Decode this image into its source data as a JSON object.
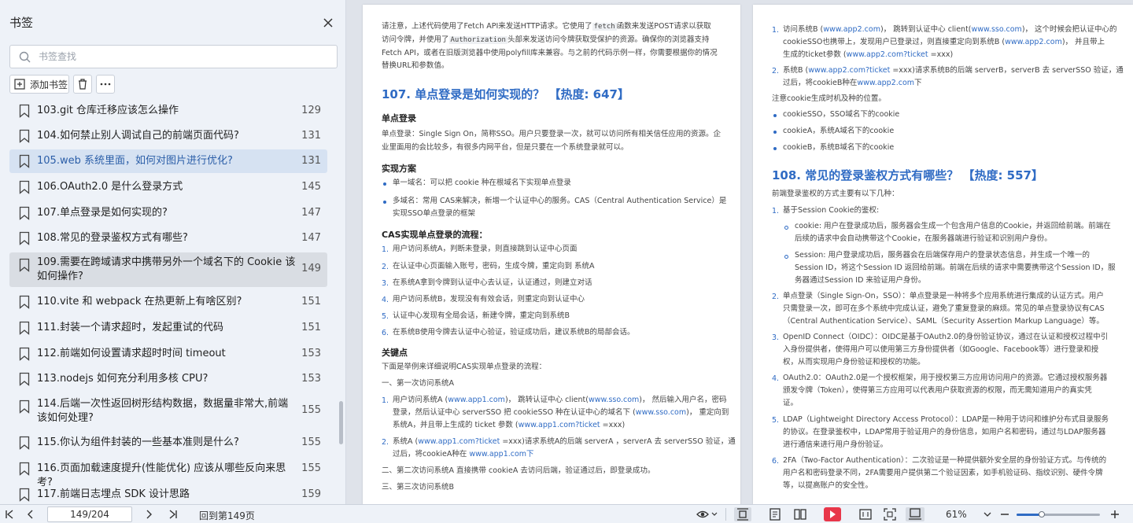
{
  "sidebar": {
    "title": "书签",
    "search_placeholder": "书签查找",
    "add_label": "添加书签",
    "items": [
      {
        "label": "103.git 仓库迁移应该怎么操作",
        "page": "129"
      },
      {
        "label": "104.如何禁止别人调试自己的前端页面代码?",
        "page": "131"
      },
      {
        "label": "105.web 系统里面，如何对图片进行优化?",
        "page": "131"
      },
      {
        "label": "106.OAuth2.0 是什么登录方式",
        "page": "145"
      },
      {
        "label": "107.单点登录是如何实现的?",
        "page": "147"
      },
      {
        "label": "108.常见的登录鉴权方式有哪些?",
        "page": "147"
      },
      {
        "label": "109.需要在跨域请求中携带另外一个域名下的 Cookie 该如何操作?",
        "page": "149"
      },
      {
        "label": "110.vite 和 webpack 在热更新上有啥区别?",
        "page": "151"
      },
      {
        "label": "111.封装一个请求超时，发起重试的代码",
        "page": "151"
      },
      {
        "label": "112.前端如何设置请求超时时间 timeout",
        "page": "153"
      },
      {
        "label": "113.nodejs 如何充分利用多核 CPU?",
        "page": "153"
      },
      {
        "label": "114.后端一次性返回树形结构数据，数据量非常大,前端该如何处理?",
        "page": "155"
      },
      {
        "label": "115.你认为组件封装的一些基本准则是什么?",
        "page": "155"
      },
      {
        "label": "116.页面加载速度提升(性能优化) 应该从哪些反向来思考?",
        "page": "155"
      },
      {
        "label": "117.前端日志埋点 SDK 设计思路",
        "page": "159"
      }
    ]
  },
  "left_page": {
    "intro_l1a": "请注意，上述代码使用了Fetch API来发送HTTP请求。它使用了",
    "intro_code1": "fetch",
    "intro_l1b": "函数来发送POST请求以获取",
    "intro_l2a": "访问令牌，并使用了",
    "intro_code2": "Authorization",
    "intro_l2b": "头部来发送访问令牌获取受保护的资源。确保你的浏览器支持",
    "intro_l3": "Fetch API，或者在旧版浏览器中使用polyfill库来兼容。与之前的代码示例一样，你需要根据你的情况",
    "intro_l4": "替换URL和参数值。",
    "heading": "107. 单点登录是如何实现的？ 【热度: 647】",
    "sso_title": "单点登录",
    "sso_l1": "单点登录：Single Sign On，简称SSO。用户只要登录一次，就可以访问所有相关信任应用的资源。企",
    "sso_l2": "业里面用的会比较多，有很多内网平台，但是只要在一个系统登录就可以。",
    "impl_title": "实现方案",
    "impl1": "单一域名：可以把 cookie 种在根域名下实现单点登录",
    "impl2_l1": "多域名：常用 CAS来解决，新增一个认证中心的服务。CAS（Central Authentication Service）是",
    "impl2_l2": "实现SSO单点登录的框架",
    "flow_title": "CAS实现单点登录的流程：",
    "flow": [
      "用户访问系统A，判断未登录，则直接跳到认证中心页面",
      "在认证中心页面输入账号，密码，生成令牌，重定向到 系统A",
      "在系统A拿到令牌到认证中心去认证，认证通过，则建立对话",
      "用户访问系统B，发现没有有效会话，则重定向到认证中心",
      "认证中心发现有全局会话，新建令牌，重定向到系统B",
      "在系统B使用令牌去认证中心验证，验证成功后，建议系统B的局部会话。"
    ],
    "key_title": "关键点",
    "key_intro": "下面是举例来详细说明CAS实现单点登录的流程：",
    "step1": "一、第一次访问系统A",
    "s1_a": "用户访问系统A (",
    "s1_link1": "www.app1.com",
    "s1_b": ")， 跳转认证中心 client(",
    "s1_link2": "www.sso.com",
    "s1_c": ")， 然后输入用户名，密码",
    "s1_l2a": "登录，然后认证中心 serverSSO 把 cookieSSO 种在认证中心的域名下 (",
    "s1_link3": "www.sso.com",
    "s1_l2b": ")， 重定向到",
    "s1_l3a": "系统A，并且带上生成的 ticket 参数 (",
    "s1_link4": "www.app1.com?ticket",
    "s1_l3b": " =xxx)",
    "s2_a": "系统A (",
    "s2_link1": "www.app1.com?ticket",
    "s2_b": " =xxx)请求系统A的后端 serverA ，serverA 去 serverSSO 验证，通",
    "s2_l2a": "过后，将cookieA种在 ",
    "s2_link2": "www.app1.com下",
    "step2": "二、第二次访问系统A 直接携带 cookieA 去访问后端，验证通过后，即登录成功。",
    "step3": "三、第三次访问系统B"
  },
  "right_page": {
    "r1_a": "访问系统B (",
    "r1_link1": "www.app2.com",
    "r1_b": ")， 跳转到认证中心 client(",
    "r1_link2": "www.sso.com",
    "r1_c": ")， 这个时候会把认证中心的",
    "r1_l2a": "cookieSSO也携带上，发现用户已登录过，则直接重定向到系统B (",
    "r1_link3": "www.app2.com",
    "r1_l2b": ")， 并且带上",
    "r1_l3a": "生成的ticket参数 (",
    "r1_link4": "www.app2.com?ticket",
    "r1_l3b": " =xxx)",
    "r2_a": "系统B (",
    "r2_link1": "www.app2.com?ticket",
    "r2_b": " =xxx)请求系统B的后端 serverB，serverB 去 serverSSO 验证，通",
    "r2_l2a": "过后，将cookieB种在",
    "r2_link2": "www.app2.com",
    "r2_l2b": "下",
    "note": "注意cookie生成时机及种的位置。",
    "cookies": [
      "cookieSSO，SSO域名下的cookie",
      "cookieA，系统A域名下的cookie",
      "cookieB，系统B域名下的cookie"
    ],
    "heading": "108. 常见的登录鉴权方式有哪些？ 【热度: 557】",
    "intro": "前端登录鉴权的方式主要有以下几种：",
    "m1": "基于Session Cookie的鉴权:",
    "m1a_l1": "cookie: 用户在登录成功后，服务器会生成一个包含用户信息的Cookie，并返回给前端。前端在",
    "m1a_l2": "后续的请求中会自动携带这个Cookie，在服务器端进行验证和识别用户身份。",
    "m1b_l1": "Session: 用户登录成功后，服务器会在后端保存用户的登录状态信息，并生成一个唯一的",
    "m1b_l2": "Session ID，将这个Session ID 返回给前端。前端在后续的请求中需要携带这个Session ID，服",
    "m1b_l3": "务器通过Session ID 来验证用户身份。",
    "m2_l1": "单点登录（Single Sign-On，SSO）：单点登录是一种将多个应用系统进行集成的认证方式。用户",
    "m2_l2": "只需登录一次，即可在多个系统中完成认证，避免了重复登录的麻烦。常见的单点登录协议有CAS",
    "m2_l3": "（Central Authentication Service）、SAML（Security Assertion Markup Language）等。",
    "m3_l1": "OpenID Connect（OIDC）：OIDC是基于OAuth2.0的身份验证协议，通过在认证和授权过程中引",
    "m3_l2": "入身份提供者，使得用户可以使用第三方身份提供者（如Google、Facebook等）进行登录和授",
    "m3_l3": "权，从而实现用户身份验证和授权的功能。",
    "m4_l1": "OAuth2.0：OAuth2.0是一个授权框架，用于授权第三方应用访问用户的资源。它通过授权服务器",
    "m4_l2": "颁发令牌（Token），使得第三方应用可以代表用户获取资源的权限，而无需知道用户的真实凭",
    "m4_l3": "证。",
    "m5_l1": "LDAP（Lightweight Directory Access Protocol）：LDAP是一种用于访问和维护分布式目录服务",
    "m5_l2": "的协议。在登录鉴权中，LDAP常用于验证用户的身份信息，如用户名和密码，通过与LDAP服务器",
    "m5_l3": "进行通信来进行用户身份验证。",
    "m6_l1": "2FA（Two-Factor Authentication）：二次验证是一种提供额外安全层的身份验证方式。与传统的",
    "m6_l2": "用户名和密码登录不同，2FA需要用户提供第二个验证因素，如手机验证码、指纹识别、硬件令牌",
    "m6_l3": "等，以提高账户的安全性。"
  },
  "bottom": {
    "page_value": "149/204",
    "back_label": "回到第149页",
    "zoom": "61%",
    "zoom_fraction": 0.3
  },
  "colors": {
    "accent": "#2f6bc4",
    "highlight": "#d6e2f2",
    "play": "#e8374a"
  }
}
